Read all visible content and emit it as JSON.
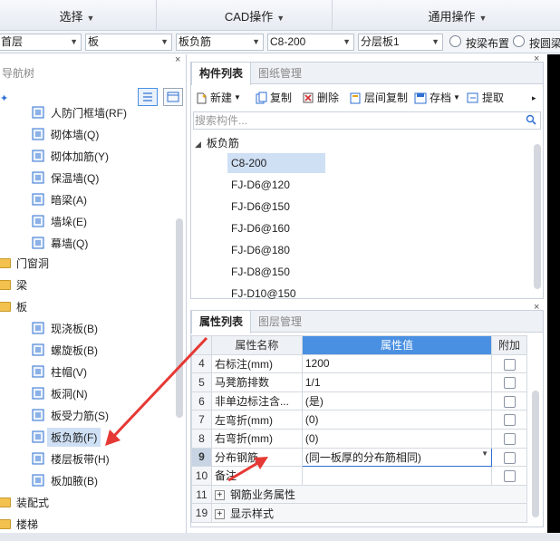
{
  "ribbon": {
    "groups": [
      {
        "label": "选择"
      },
      {
        "label": "CAD操作"
      },
      {
        "label": "通用操作"
      }
    ]
  },
  "selector": {
    "floor": "首层",
    "category": "板",
    "component_type": "板负筋",
    "spec": "C8-200",
    "layer": "分层板1",
    "option1": "按梁布置",
    "option2": "按圆梁"
  },
  "nav": {
    "title": "导航树",
    "items": [
      {
        "label": "人防门框墙(RF)",
        "icon": "blast-door-wall-icon"
      },
      {
        "label": "砌体墙(Q)",
        "icon": "masonry-wall-icon"
      },
      {
        "label": "砌体加筋(Y)",
        "icon": "masonry-rebar-icon"
      },
      {
        "label": "保温墙(Q)",
        "icon": "insulation-wall-icon"
      },
      {
        "label": "暗梁(A)",
        "icon": "hidden-beam-icon"
      },
      {
        "label": "墙垛(E)",
        "icon": "wall-pier-icon"
      },
      {
        "label": "幕墙(Q)",
        "icon": "curtain-wall-icon"
      },
      {
        "label": "门窗洞",
        "icon": "folder-icon"
      },
      {
        "label": "梁",
        "icon": "folder-icon"
      },
      {
        "label": "板",
        "icon": "folder-icon"
      },
      {
        "label": "现浇板(B)",
        "icon": "cast-slab-icon"
      },
      {
        "label": "螺旋板(B)",
        "icon": "spiral-slab-icon"
      },
      {
        "label": "柱帽(V)",
        "icon": "column-cap-icon"
      },
      {
        "label": "板洞(N)",
        "icon": "slab-hole-icon"
      },
      {
        "label": "板受力筋(S)",
        "icon": "slab-main-rebar-icon"
      },
      {
        "label": "板负筋(F)",
        "icon": "slab-negative-rebar-icon"
      },
      {
        "label": "楼层板带(H)",
        "icon": "floor-strip-icon"
      },
      {
        "label": "板加腋(B)",
        "icon": "slab-haunch-icon"
      },
      {
        "label": "装配式",
        "icon": "folder-icon"
      },
      {
        "label": "楼梯",
        "icon": "folder-icon"
      }
    ]
  },
  "component_list": {
    "tabs": [
      "构件列表",
      "图纸管理"
    ],
    "toolbar": [
      "新建",
      "复制",
      "删除",
      "层间复制",
      "存档",
      "提取"
    ],
    "search_placeholder": "搜索构件...",
    "tree_root": "板负筋",
    "items": [
      "C8-200",
      "FJ-D6@120",
      "FJ-D6@150",
      "FJ-D6@160",
      "FJ-D6@180",
      "FJ-D8@150",
      "FJ-D10@150"
    ]
  },
  "properties": {
    "tabs": [
      "属性列表",
      "图层管理"
    ],
    "headers": {
      "name": "属性名称",
      "value": "属性值",
      "extra": "附加"
    },
    "rows": [
      {
        "num": "4",
        "name": "右标注(mm)",
        "value": "1200"
      },
      {
        "num": "5",
        "name": "马凳筋排数",
        "value": "1/1"
      },
      {
        "num": "6",
        "name": "非单边标注含...",
        "value": "(是)"
      },
      {
        "num": "7",
        "name": "左弯折(mm)",
        "value": "(0)"
      },
      {
        "num": "8",
        "name": "右弯折(mm)",
        "value": "(0)"
      },
      {
        "num": "9",
        "name": "分布钢筋",
        "value": "(同一板厚的分布筋相同)"
      },
      {
        "num": "10",
        "name": "备注",
        "value": ""
      },
      {
        "num": "11",
        "name": "钢筋业务属性",
        "value": ""
      },
      {
        "num": "19",
        "name": "显示样式",
        "value": ""
      }
    ]
  },
  "colors": {
    "accent": "#4a90e2",
    "selection": "#cfe0f5",
    "annotation_arrow": "#e53935"
  }
}
